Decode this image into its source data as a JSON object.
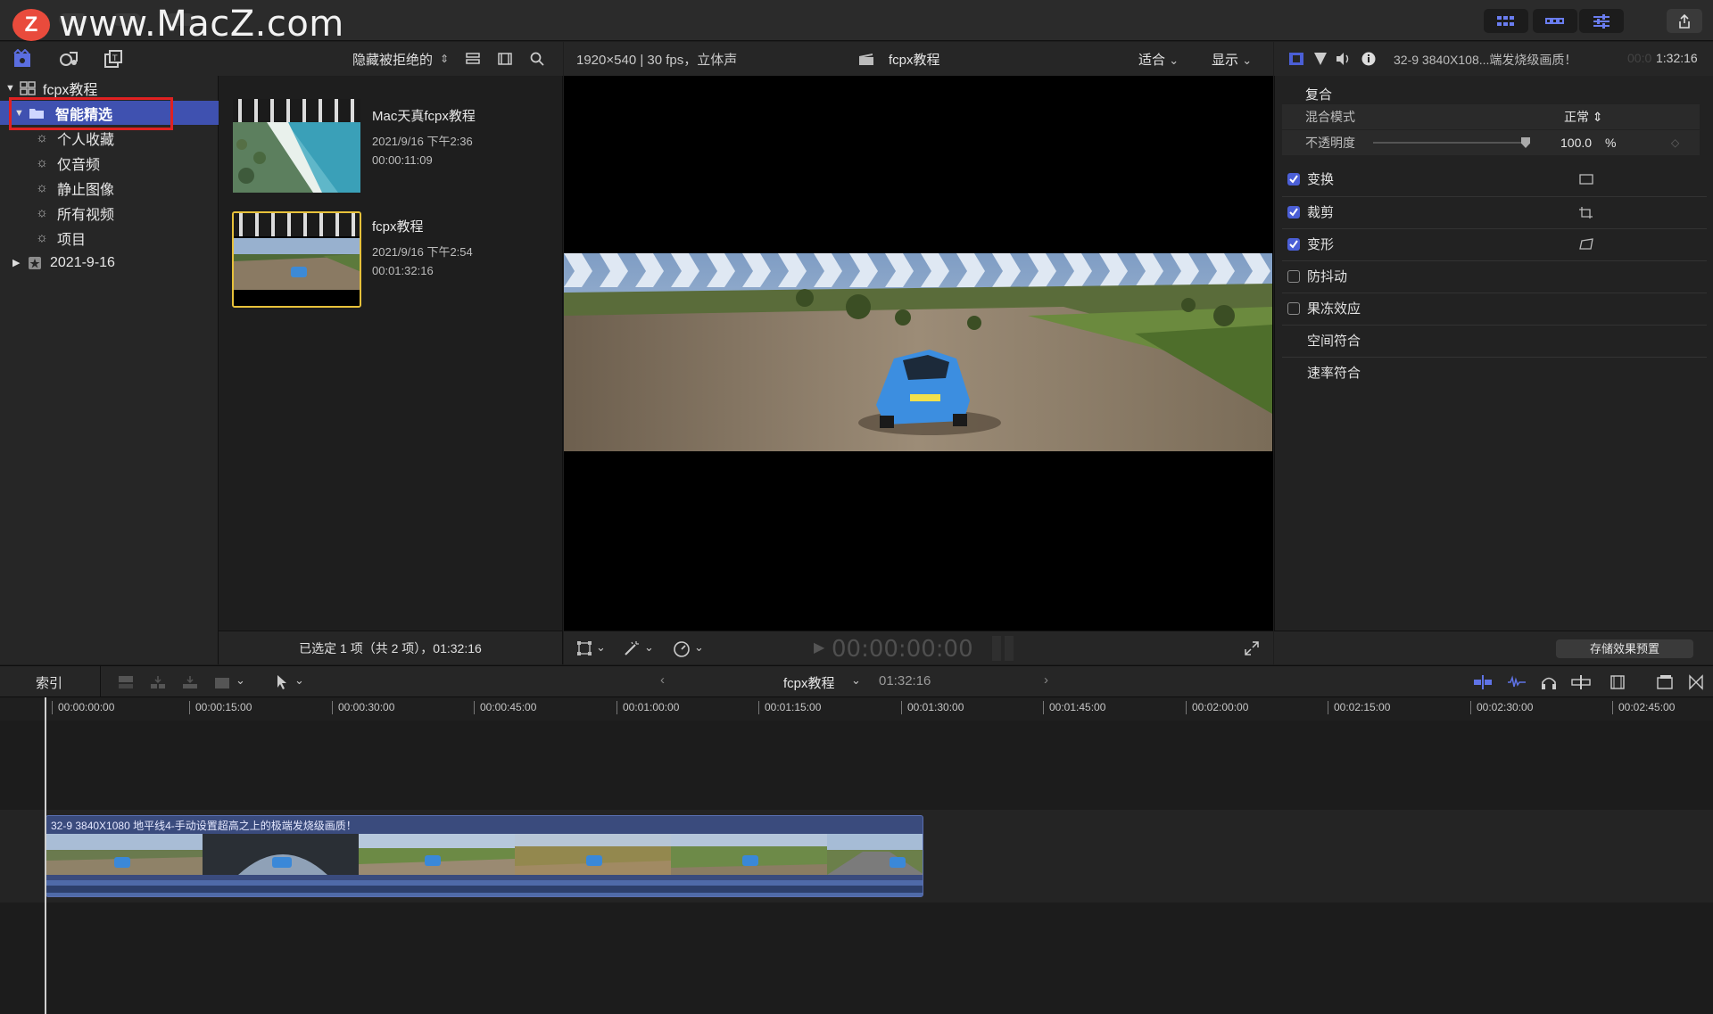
{
  "watermark": {
    "badge": "Z",
    "text": "www.MacZ.com"
  },
  "browser": {
    "filter_label": "隐藏被拒绝的",
    "status": "已选定 1 项（共 2 项），01:32:16",
    "clips": [
      {
        "title": "Mac天真fcpx教程",
        "date": "2021/9/16 下午2:36",
        "duration": "00:00:11:09"
      },
      {
        "title": "fcpx教程",
        "date": "2021/9/16 下午2:54",
        "duration": "00:01:32:16"
      }
    ]
  },
  "library": {
    "name": "fcpx教程",
    "items": [
      {
        "label": "智能精选",
        "selected": true
      },
      {
        "label": "个人收藏"
      },
      {
        "label": "仅音频"
      },
      {
        "label": "静止图像"
      },
      {
        "label": "所有视频"
      },
      {
        "label": "项目"
      }
    ],
    "event": "2021-9-16"
  },
  "viewer": {
    "format": "1920×540 | 30 fps，立体声",
    "project": "fcpx教程",
    "fit_label": "适合",
    "display_label": "显示",
    "timecode": "00:00:00:00"
  },
  "inspector": {
    "clip_name": "32-9 3840X108...端发烧级画质！",
    "time_dim": "00:0",
    "time": "1:32:16",
    "section_title": "复合",
    "blend_label": "混合模式",
    "blend_value": "正常",
    "opacity_label": "不透明度",
    "opacity_value": "100.0",
    "opacity_unit": "%",
    "effects": [
      {
        "label": "变换",
        "checked": true
      },
      {
        "label": "裁剪",
        "checked": true
      },
      {
        "label": "变形",
        "checked": true
      },
      {
        "label": "防抖动",
        "checked": false
      },
      {
        "label": "果冻效应",
        "checked": false
      },
      {
        "label": "空间符合"
      },
      {
        "label": "速率符合"
      }
    ],
    "save_preset": "存储效果预置"
  },
  "timeline": {
    "index_label": "索引",
    "project": "fcpx教程",
    "duration": "01:32:16",
    "ruler": [
      "00:00:00:00",
      "00:00:15:00",
      "00:00:30:00",
      "00:00:45:00",
      "00:01:00:00",
      "00:01:15:00",
      "00:01:30:00",
      "00:01:45:00",
      "00:02:00:00",
      "00:02:15:00",
      "00:02:30:00",
      "00:02:45:00"
    ],
    "clip_title": "32-9 3840X1080 地平线4-手动设置超高之上的极端发烧级画质！"
  },
  "colors": {
    "accent": "#4b5fd6",
    "selection": "#3f51b0",
    "highlight_box": "#e02121",
    "clip_border": "#e7c13a"
  }
}
